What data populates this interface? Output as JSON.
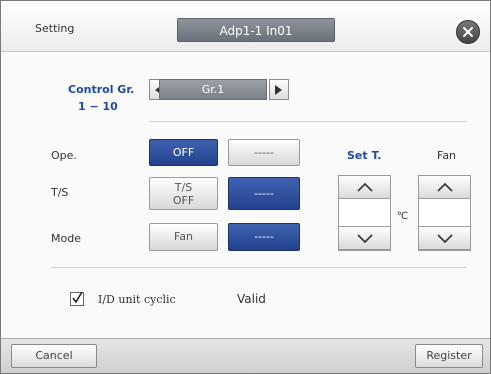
{
  "header": {
    "title": "Setting",
    "unit_name": "Adp1-1 In01"
  },
  "control_group": {
    "label_line1": "Control Gr.",
    "label_line2": "1 − 10",
    "value": "Gr.1"
  },
  "ope": {
    "label": "Ope.",
    "option_on": "OFF",
    "option_off": "-----"
  },
  "ts": {
    "label": "T/S",
    "option_a_line1": "T/S",
    "option_a_line2": "OFF",
    "option_b": "-----"
  },
  "mode": {
    "label": "Mode",
    "option_a": "Fan",
    "option_b": "-----"
  },
  "set_temp": {
    "label": "Set T.",
    "value": "",
    "unit": "℃"
  },
  "fan": {
    "label": "Fan",
    "value": ""
  },
  "cyclic": {
    "label": "I/D unit cyclic",
    "checked": true,
    "status": "Valid"
  },
  "footer": {
    "cancel_label": "Cancel",
    "register_label": "Register"
  },
  "colors": {
    "selected_blue": "#23428d",
    "label_blue": "#1f4aa6"
  }
}
